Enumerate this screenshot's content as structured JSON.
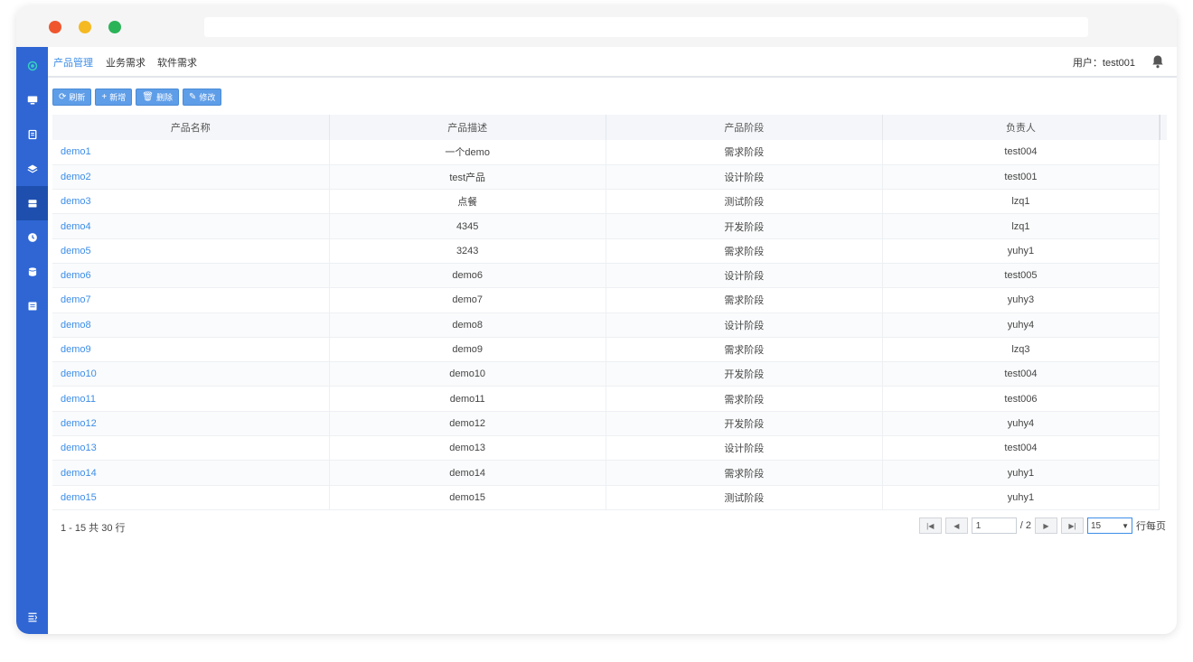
{
  "nav": {
    "items": [
      "产品管理",
      "业务需求",
      "软件需求"
    ],
    "user_label": "用户：test001"
  },
  "toolbar": {
    "refresh": "刷新",
    "add": "新增",
    "delete": "删除",
    "edit": "修改"
  },
  "table": {
    "headers": [
      "产品名称",
      "产品描述",
      "产品阶段",
      "负责人"
    ],
    "rows": [
      [
        "demo1",
        "一个demo",
        "需求阶段",
        "test004"
      ],
      [
        "demo2",
        "test产品",
        "设计阶段",
        "test001"
      ],
      [
        "demo3",
        "点餐",
        "测试阶段",
        "lzq1"
      ],
      [
        "demo4",
        "4345",
        "开发阶段",
        "lzq1"
      ],
      [
        "demo5",
        "3243",
        "需求阶段",
        "yuhy1"
      ],
      [
        "demo6",
        "demo6",
        "设计阶段",
        "test005"
      ],
      [
        "demo7",
        "demo7",
        "需求阶段",
        "yuhy3"
      ],
      [
        "demo8",
        "demo8",
        "设计阶段",
        "yuhy4"
      ],
      [
        "demo9",
        "demo9",
        "需求阶段",
        "lzq3"
      ],
      [
        "demo10",
        "demo10",
        "开发阶段",
        "test004"
      ],
      [
        "demo11",
        "demo11",
        "需求阶段",
        "test006"
      ],
      [
        "demo12",
        "demo12",
        "开发阶段",
        "yuhy4"
      ],
      [
        "demo13",
        "demo13",
        "设计阶段",
        "test004"
      ],
      [
        "demo14",
        "demo14",
        "需求阶段",
        "yuhy1"
      ],
      [
        "demo15",
        "demo15",
        "测试阶段",
        "yuhy1"
      ]
    ]
  },
  "footer": {
    "count_text": "1 - 15 共 30 行"
  },
  "pager": {
    "page_value": "1",
    "total_text": "/ 2",
    "page_size": "15",
    "per_page_label": "行每页"
  },
  "icons": {
    "sidebar": [
      "app-logo-icon",
      "monitor-icon",
      "document-icon",
      "layers-icon",
      "product-icon",
      "clock-icon",
      "database-icon",
      "list-icon",
      "collapse-menu-icon"
    ],
    "nav": [
      "bell-icon"
    ]
  },
  "colors": {
    "sidebar": "#2f66d4",
    "sidebar_active": "#1e4fae",
    "link": "#3d8ee8",
    "button": "#5e9de8"
  }
}
